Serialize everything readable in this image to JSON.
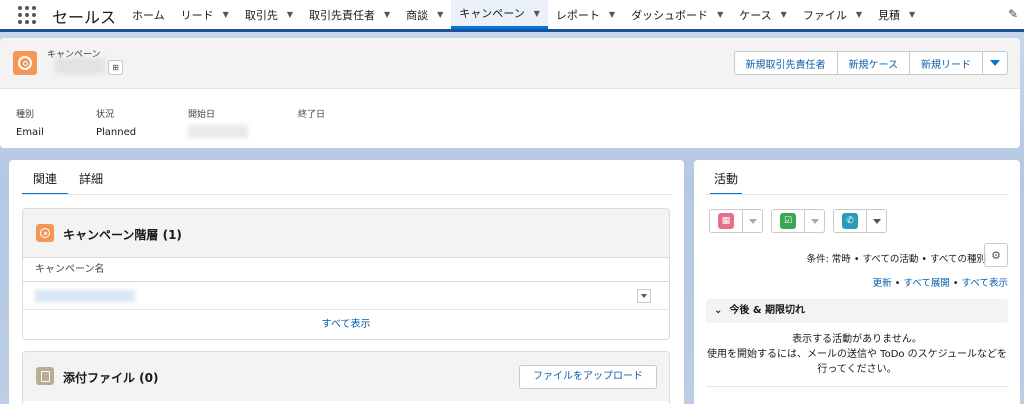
{
  "nav": {
    "app_name": "セールス",
    "items": [
      {
        "label": "ホーム",
        "chevron": false,
        "active": false
      },
      {
        "label": "リード",
        "chevron": true,
        "active": false
      },
      {
        "label": "取引先",
        "chevron": true,
        "active": false
      },
      {
        "label": "取引先責任者",
        "chevron": true,
        "active": false
      },
      {
        "label": "商談",
        "chevron": true,
        "active": false
      },
      {
        "label": "キャンペーン",
        "chevron": true,
        "active": true
      },
      {
        "label": "レポート",
        "chevron": true,
        "active": false
      },
      {
        "label": "ダッシュボード",
        "chevron": true,
        "active": false
      },
      {
        "label": "ケース",
        "chevron": true,
        "active": false
      },
      {
        "label": "ファイル",
        "chevron": true,
        "active": false
      },
      {
        "label": "見積",
        "chevron": true,
        "active": false
      }
    ]
  },
  "record": {
    "object_type": "キャンペーン",
    "actions": [
      "新規取引先責任者",
      "新規ケース",
      "新規リード"
    ],
    "fields": [
      {
        "label": "種別",
        "value": "Email"
      },
      {
        "label": "状況",
        "value": "Planned"
      },
      {
        "label": "開始日",
        "value": ""
      },
      {
        "label": "終了日",
        "value": ""
      }
    ]
  },
  "main": {
    "tabs": [
      "関連",
      "詳細"
    ],
    "hierarchy": {
      "title": "キャンペーン階層 (1)",
      "column": "キャンペーン名",
      "view_all": "すべて表示"
    },
    "files": {
      "title": "添付ファイル (0)",
      "upload": "ファイルをアップロード"
    }
  },
  "activity": {
    "tab": "活動",
    "filter_text": "条件: 常時 • すべての活動 • すべての種別",
    "link_refresh": "更新",
    "link_expand": "すべて展開",
    "link_show": "すべて表示",
    "section": "今後 & 期限切れ",
    "empty_line1": "表示する活動がありません。",
    "empty_line2": "使用を開始するには、メールの送信や ToDo のスケジュールなどを",
    "empty_line3": "行ってください。"
  },
  "colors": {
    "accent": "#0176d3",
    "campaign_icon": "#f49756",
    "file_icon": "#baac93"
  }
}
